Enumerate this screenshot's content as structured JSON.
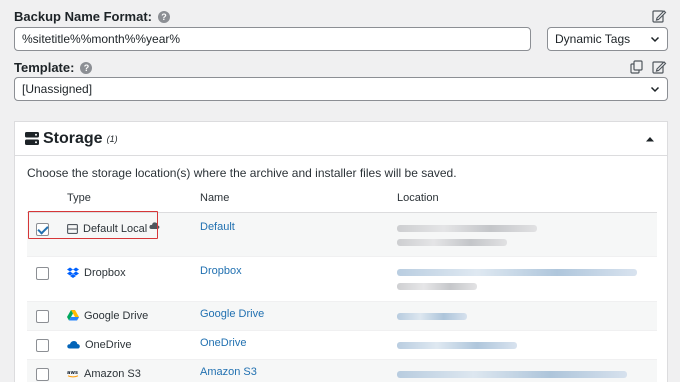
{
  "backup_name": {
    "label": "Backup Name Format:",
    "help": "?",
    "value": "%sitetitle%%month%%year%",
    "dynamic_tags": "Dynamic Tags"
  },
  "template": {
    "label": "Template:",
    "help": "?",
    "value": "[Unassigned]"
  },
  "storage": {
    "title": "Storage",
    "count": "(1)",
    "description": "Choose the storage location(s) where the archive and installer files will be saved.",
    "columns": [
      "Type",
      "Name",
      "Location"
    ],
    "rows": [
      {
        "type": "Default Local",
        "name": "Default",
        "checked": true,
        "icon": "hard-drive-icon"
      },
      {
        "type": "Dropbox",
        "name": "Dropbox",
        "checked": false,
        "icon": "dropbox-icon"
      },
      {
        "type": "Google Drive",
        "name": "Google Drive",
        "checked": false,
        "icon": "google-drive-icon"
      },
      {
        "type": "OneDrive",
        "name": "OneDrive",
        "checked": false,
        "icon": "onedrive-icon"
      },
      {
        "type": "Amazon S3",
        "name": "Amazon S3",
        "checked": false,
        "icon": "aws-icon"
      }
    ]
  },
  "colors": {
    "link": "#2271b1",
    "highlight": "#d63638",
    "background": "#f0f0f1"
  }
}
